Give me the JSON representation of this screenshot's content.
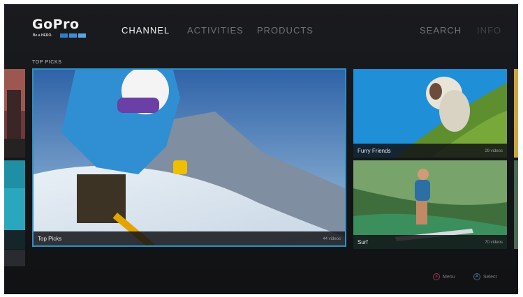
{
  "brand": {
    "name": "GoPro",
    "tagline": "Be a HERO.",
    "colors": [
      "#2f7fc3",
      "#3b8fd6",
      "#5aa6e4"
    ]
  },
  "nav": {
    "channel": "CHANNEL",
    "activities": "ACTIVITIES",
    "products": "PRODUCTS",
    "search": "SEARCH",
    "info": "INFO",
    "active": "CHANNEL",
    "accent": "#2d8fc6"
  },
  "section": {
    "title": "TOP PICKS"
  },
  "tiles": [
    {
      "title": "Top Picks",
      "count": "44 videos",
      "icon": "ski-photo"
    },
    {
      "title": "Furry Friends",
      "count": "29 videos",
      "icon": "dog-photo"
    },
    {
      "title": "Surf",
      "count": "70 videos",
      "icon": "surf-photo"
    }
  ],
  "hints": {
    "menu": {
      "button": "≡",
      "label": "Menu"
    },
    "select": {
      "button": "A",
      "label": "Select"
    }
  }
}
